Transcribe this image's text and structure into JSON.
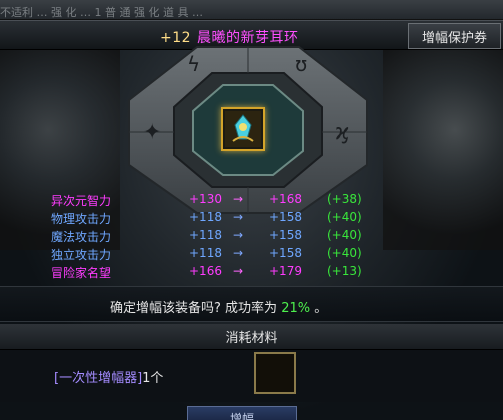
{
  "top_strip": {
    "text": "不适利 … 强 化 … 1 普 通 强 化 道 具 …"
  },
  "header": {
    "enhance_level": "+12",
    "item_name": "晨曦的新芽耳环",
    "ticket_button": "增幅保护券"
  },
  "slot": {
    "icon": "earring-item-icon"
  },
  "stats": [
    {
      "name": "异次元智力",
      "from": "+130",
      "arrow": "→",
      "to": "+168",
      "diff": "(+38)",
      "color": "pink"
    },
    {
      "name": "物理攻击力",
      "from": "+118",
      "arrow": "→",
      "to": "+158",
      "diff": "(+40)",
      "color": "blue"
    },
    {
      "name": "魔法攻击力",
      "from": "+118",
      "arrow": "→",
      "to": "+158",
      "diff": "(+40)",
      "color": "blue"
    },
    {
      "name": "独立攻击力",
      "from": "+118",
      "arrow": "→",
      "to": "+158",
      "diff": "(+40)",
      "color": "blue"
    },
    {
      "name": "冒险家名望",
      "from": "+166",
      "arrow": "→",
      "to": "+179",
      "diff": "(+13)",
      "color": "pink"
    }
  ],
  "confirm": {
    "prefix": "确定增幅该装备吗? 成功率为",
    "rate": "21%",
    "suffix": "。"
  },
  "materials": {
    "header": "消耗材料",
    "item_name": "[一次性增幅器]",
    "item_count": "1个"
  },
  "bottom_button": {
    "label": "增幅"
  },
  "colors": {
    "pink": "#ff3cff",
    "blue": "#6fa7ff",
    "green": "#39e63b",
    "gold_border": "#d4a42a"
  }
}
